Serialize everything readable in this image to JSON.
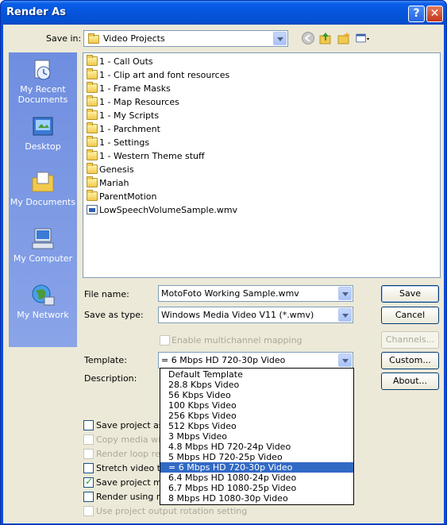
{
  "window": {
    "title": "Render As"
  },
  "toolbar": {
    "save_in_label": "Save in:",
    "save_in_value": "Video Projects"
  },
  "places": [
    {
      "label_line1": "My Recent",
      "label_line2": "Documents",
      "icon": "recent-documents-icon"
    },
    {
      "label_line1": "Desktop",
      "label_line2": "",
      "icon": "desktop-icon"
    },
    {
      "label_line1": "My Documents",
      "label_line2": "",
      "icon": "my-documents-icon"
    },
    {
      "label_line1": "My Computer",
      "label_line2": "",
      "icon": "my-computer-icon"
    },
    {
      "label_line1": "My Network",
      "label_line2": "",
      "icon": "my-network-icon"
    }
  ],
  "files": [
    {
      "name": "1 - Call Outs",
      "type": "folder"
    },
    {
      "name": "1 - Clip art and font resources",
      "type": "folder"
    },
    {
      "name": "1 - Frame Masks",
      "type": "folder"
    },
    {
      "name": "1 - Map Resources",
      "type": "folder"
    },
    {
      "name": "1 - My Scripts",
      "type": "folder"
    },
    {
      "name": "1 - Parchment",
      "type": "folder"
    },
    {
      "name": "1 - Settings",
      "type": "folder"
    },
    {
      "name": "1 - Western Theme stuff",
      "type": "folder"
    },
    {
      "name": "Genesis",
      "type": "folder"
    },
    {
      "name": "Mariah",
      "type": "folder"
    },
    {
      "name": "ParentMotion",
      "type": "folder"
    },
    {
      "name": "LowSpeechVolumeSample.wmv",
      "type": "wmv"
    }
  ],
  "form": {
    "file_name_label": "File name:",
    "file_name_value": "MotoFoto Working Sample.wmv",
    "save_as_type_label": "Save as type:",
    "save_as_type_value": "Windows Media Video V11 (*.wmv)",
    "multichannel_label": "Enable multichannel mapping",
    "template_label": "Template:",
    "template_value": "= 6 Mbps HD 720-30p Video",
    "description_label": "Description:"
  },
  "buttons": {
    "save": "Save",
    "cancel": "Cancel",
    "channels": "Channels...",
    "custom": "Custom...",
    "about": "About..."
  },
  "options": [
    {
      "label": "Save project as p",
      "checked": false,
      "disabled": false
    },
    {
      "label": "Copy media with",
      "checked": false,
      "disabled": true
    },
    {
      "label": "Render loop regio",
      "checked": false,
      "disabled": true
    },
    {
      "label": "Stretch video to",
      "checked": false,
      "disabled": false
    },
    {
      "label": "Save project mar",
      "checked": true,
      "disabled": false
    },
    {
      "label": "Render using net",
      "checked": false,
      "disabled": false
    },
    {
      "label": "Use project output rotation setting",
      "checked": false,
      "disabled": true
    }
  ],
  "template_dropdown": {
    "selected_index": 11,
    "items": [
      "Default Template",
      "28.8 Kbps Video",
      "56 Kbps Video",
      "100 Kbps Video",
      "256 Kbps Video",
      "512 Kbps Video",
      "3 Mbps Video",
      "4.8 Mbps HD 720-24p Video",
      "5 Mbps HD 720-25p Video",
      "= 6 Mbps HD 720-30p Video",
      "6.4 Mbps HD 1080-24p Video",
      "6.7 Mbps HD 1080-25p Video",
      "8 Mbps HD 1080-30p Video"
    ]
  },
  "colors": {
    "title_bar": "#0555dc",
    "dialog_bg": "#ece9d8",
    "selection": "#316ac5",
    "places_bar": "#7a96df"
  }
}
